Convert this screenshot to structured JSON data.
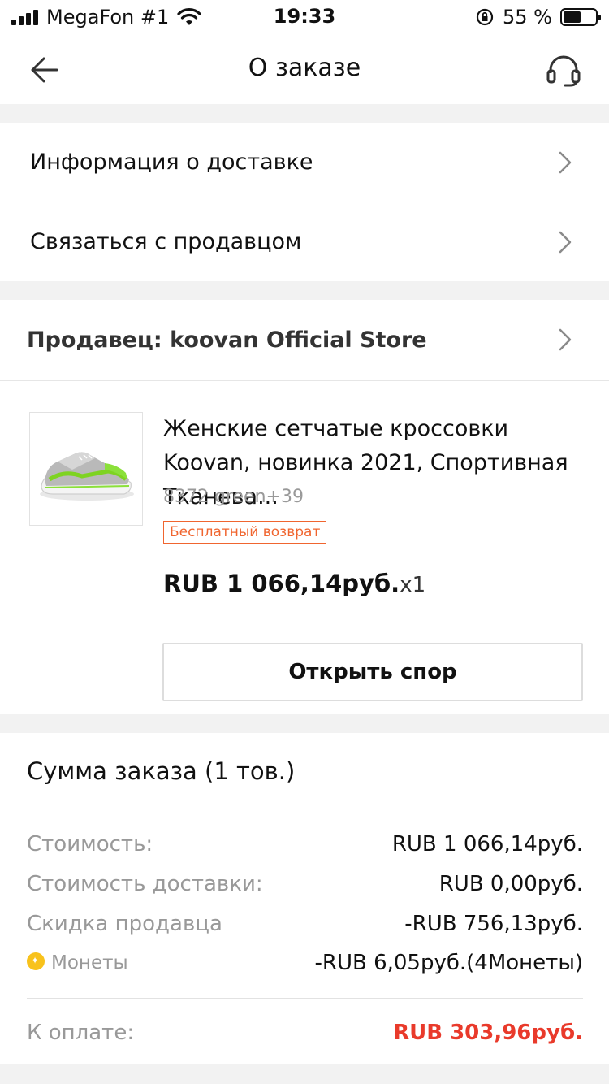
{
  "status_bar": {
    "carrier": "MegaFon #1",
    "time": "19:33",
    "battery_percent": "55 %",
    "battery_level": 0.55
  },
  "nav": {
    "title": "О заказе",
    "back_icon": "arrow-left-icon",
    "support_icon": "headset-icon"
  },
  "menu": {
    "delivery_info": "Информация о доставке",
    "contact_seller": "Связаться с продавцом"
  },
  "seller": {
    "label": "Продавец: koovan Official Store"
  },
  "product": {
    "title": "Женские сетчатые кроссовки Koovan, новинка 2021, Спортивная Тканева...",
    "sku": "8372 green+39",
    "badge": "Бесплатный возврат",
    "price": "RUB 1 066,14руб.",
    "quantity": "x1",
    "dispute_button": "Открыть спор"
  },
  "summary": {
    "title": "Сумма заказа (1 тов.)",
    "rows": [
      {
        "label": "Стоимость:",
        "value": "RUB 1 066,14руб."
      },
      {
        "label": "Стоимость доставки:",
        "value": "RUB 0,00руб."
      },
      {
        "label": "Скидка продавца",
        "value": "-RUB 756,13руб."
      },
      {
        "label": "Монеты",
        "value": "-RUB 6,05руб.(4Монеты)"
      }
    ],
    "total_label": "К оплате:",
    "total_value": "RUB 303,96руб."
  },
  "colors": {
    "accent_red": "#e93a2b",
    "badge_orange": "#f0652f",
    "coin_yellow": "#f8c21c"
  }
}
